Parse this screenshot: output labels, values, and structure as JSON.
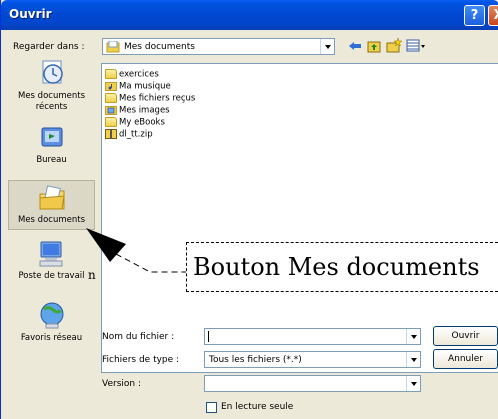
{
  "window": {
    "title": "Ouvrir",
    "help_symbol": "?",
    "close_symbol": "X"
  },
  "lookin": {
    "label": "Regarder dans :",
    "value": "Mes documents"
  },
  "places": [
    {
      "label": "Mes documents récents",
      "icon": "recent-documents-icon"
    },
    {
      "label": "Bureau",
      "icon": "desktop-icon"
    },
    {
      "label": "Mes documents",
      "icon": "my-documents-icon",
      "selected": true
    },
    {
      "label": "Poste de travail",
      "icon": "my-computer-icon"
    },
    {
      "label": "Favoris réseau",
      "icon": "network-places-icon"
    }
  ],
  "files": [
    {
      "name": "exercices",
      "icon": "folder-icon"
    },
    {
      "name": "Ma musique",
      "icon": "music-folder-icon"
    },
    {
      "name": "Mes fichiers reçus",
      "icon": "folder-icon"
    },
    {
      "name": "Mes images",
      "icon": "pictures-folder-icon"
    },
    {
      "name": "My eBooks",
      "icon": "folder-icon"
    },
    {
      "name": "dl_tt.zip",
      "icon": "zip-icon"
    }
  ],
  "form": {
    "filename_label": "Nom du fichier :",
    "filename_value": "",
    "filetype_label": "Fichiers de type :",
    "filetype_value": "Tous les fichiers (*.*)",
    "version_label": "Version :",
    "version_value": "",
    "readonly_label": "En lecture seule",
    "readonly_checked": false
  },
  "buttons": {
    "open": "Ouvrir",
    "cancel": "Annuler"
  },
  "annotation": {
    "callout_text": "Bouton Mes documents",
    "outside_fragment": "n"
  },
  "colors": {
    "titlebar": "#0148d0",
    "dialog_bg": "#ece9d8",
    "selected_place_bg": "#dcd8c8"
  }
}
